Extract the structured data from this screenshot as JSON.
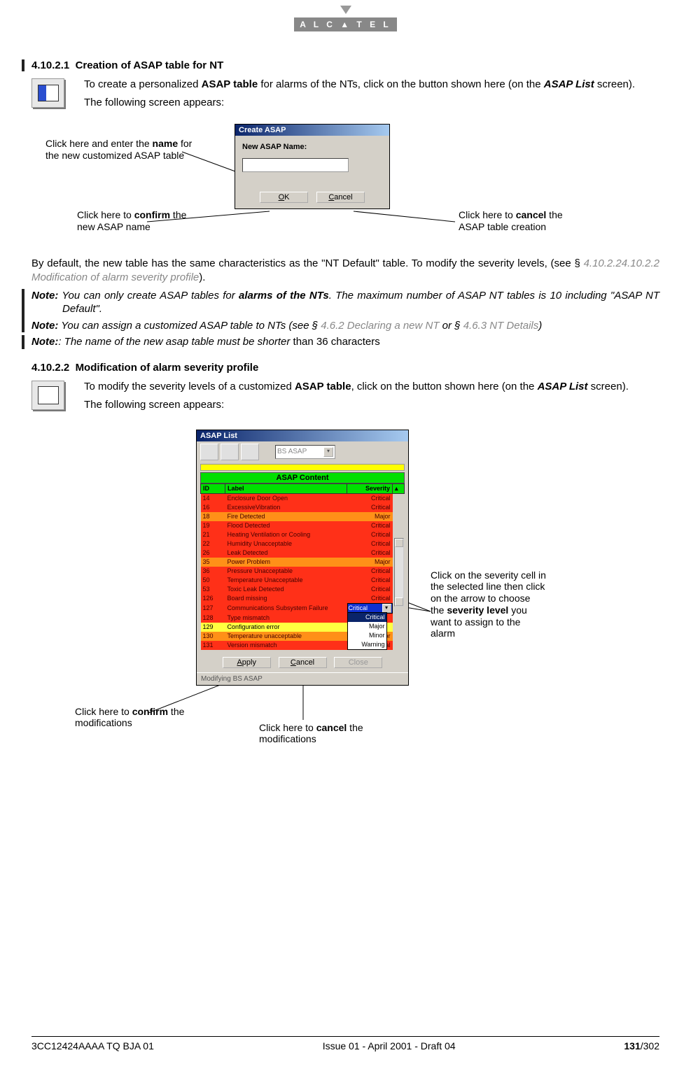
{
  "logo": "A L C ▲ T E L",
  "section1": {
    "number": "4.10.2.1",
    "title": "Creation of ASAP table for NT",
    "para1_a": "To create a personalized ",
    "para1_b": "ASAP table",
    "para1_c": " for alarms of the NTs, click on the button shown here (on the ",
    "para1_d": "ASAP List",
    "para1_e": " screen).",
    "para2": "The following screen appears:"
  },
  "dialog1": {
    "title": "Create ASAP",
    "label": "New ASAP Name:",
    "ok": "OK",
    "cancel": "Cancel"
  },
  "callouts1": {
    "name_a": "Click here and enter the ",
    "name_b": "name",
    "name_c": " for the new customized ASAP table",
    "confirm_a": "Click here to ",
    "confirm_b": "confirm",
    "confirm_c": " the new ASAP name",
    "cancel_a": "Click here to ",
    "cancel_b": "cancel",
    "cancel_c": " the ASAP table creation"
  },
  "para_after1_a": "By default, the new table has the same characteristics as the \"NT Default\" table. To modify the severity levels, (see § ",
  "para_after1_link": "4.10.2.24.10.2.2 Modification of alarm severity profile",
  "para_after1_b": ").",
  "notes": {
    "label": "Note:",
    "n1_a": " You can only create ASAP tables for ",
    "n1_b": "alarms of the NTs",
    "n1_c": ". The maximum number of ASAP NT tables is 10 including \"ASAP NT Default\".",
    "n2_a": " You can assign a customized ASAP table to NTs (see § ",
    "n2_link1": "4.6.2 Declaring a new NT",
    "n2_b": " or § ",
    "n2_link2": "4.6.3 NT Details",
    "n2_c": ")",
    "n3_a": ": The name of the new asap table must be shorter",
    "n3_b": " than 36 characters"
  },
  "section2": {
    "number": "4.10.2.2",
    "title": "Modification of alarm severity profile",
    "para1_a": "To modify the severity levels of a customized ",
    "para1_b": "ASAP table",
    "para1_c": ", click on the button shown here (on the ",
    "para1_d": "ASAP List",
    "para1_e": " screen).",
    "para2": "The following screen appears:"
  },
  "dialog2": {
    "title": "ASAP List",
    "combo": "BS ASAP",
    "content_header": "ASAP Content",
    "col_id": "ID",
    "col_label": "Label",
    "col_sev": "Severity",
    "rows": [
      {
        "id": "14",
        "label": "Enclosure Door Open",
        "sev": "Critical",
        "cls": "red"
      },
      {
        "id": "16",
        "label": "ExcessiveVibration",
        "sev": "Critical",
        "cls": "red"
      },
      {
        "id": "18",
        "label": "Fire Detected",
        "sev": "Major",
        "cls": "orange"
      },
      {
        "id": "19",
        "label": "Flood Detected",
        "sev": "Critical",
        "cls": "red"
      },
      {
        "id": "21",
        "label": "Heating Ventilation or Cooling",
        "sev": "Critical",
        "cls": "red"
      },
      {
        "id": "22",
        "label": "Humidity Unacceptable",
        "sev": "Critical",
        "cls": "red"
      },
      {
        "id": "26",
        "label": "Leak Detected",
        "sev": "Critical",
        "cls": "red"
      },
      {
        "id": "35",
        "label": "Power Problem",
        "sev": "Major",
        "cls": "orange"
      },
      {
        "id": "36",
        "label": "Pressure Unacceptable",
        "sev": "Critical",
        "cls": "red"
      },
      {
        "id": "50",
        "label": "Temperature Unacceptable",
        "sev": "Critical",
        "cls": "red"
      },
      {
        "id": "53",
        "label": "Toxic Leak Detected",
        "sev": "Critical",
        "cls": "red"
      },
      {
        "id": "126",
        "label": "Board missing",
        "sev": "Critical",
        "cls": "red"
      },
      {
        "id": "127",
        "label": "Communications Subsystem Failure",
        "sev": "__combo__",
        "cls": "red"
      },
      {
        "id": "128",
        "label": "Type mismatch",
        "sev": "",
        "cls": "red"
      },
      {
        "id": "129",
        "label": "Configuration error",
        "sev": "",
        "cls": "yellow"
      },
      {
        "id": "130",
        "label": "Temperature unacceptable",
        "sev": "Major",
        "cls": "orange"
      },
      {
        "id": "131",
        "label": "Version mismatch",
        "sev": "Critical",
        "cls": "red"
      }
    ],
    "combo_selected": "Critical",
    "dropdown": [
      "Critical",
      "Major",
      "Minor",
      "Warning"
    ],
    "apply": "Apply",
    "cancel": "Cancel",
    "close": "Close",
    "status": "Modifying BS ASAP"
  },
  "callouts2": {
    "sev_a": "Click on the severity cell in the selected line then click on the arrow to choose the ",
    "sev_b": "severity level",
    "sev_c": " you want to assign to the alarm",
    "confirm_a": "Click here to ",
    "confirm_b": "confirm",
    "confirm_c": " the modifications",
    "cancel_a": "Click here to ",
    "cancel_b": "cancel",
    "cancel_c": " the modifications"
  },
  "footer": {
    "left": "3CC12424AAAA TQ BJA 01",
    "center": "Issue 01 - April 2001 - Draft 04",
    "page_current": "131",
    "page_total": "/302"
  }
}
